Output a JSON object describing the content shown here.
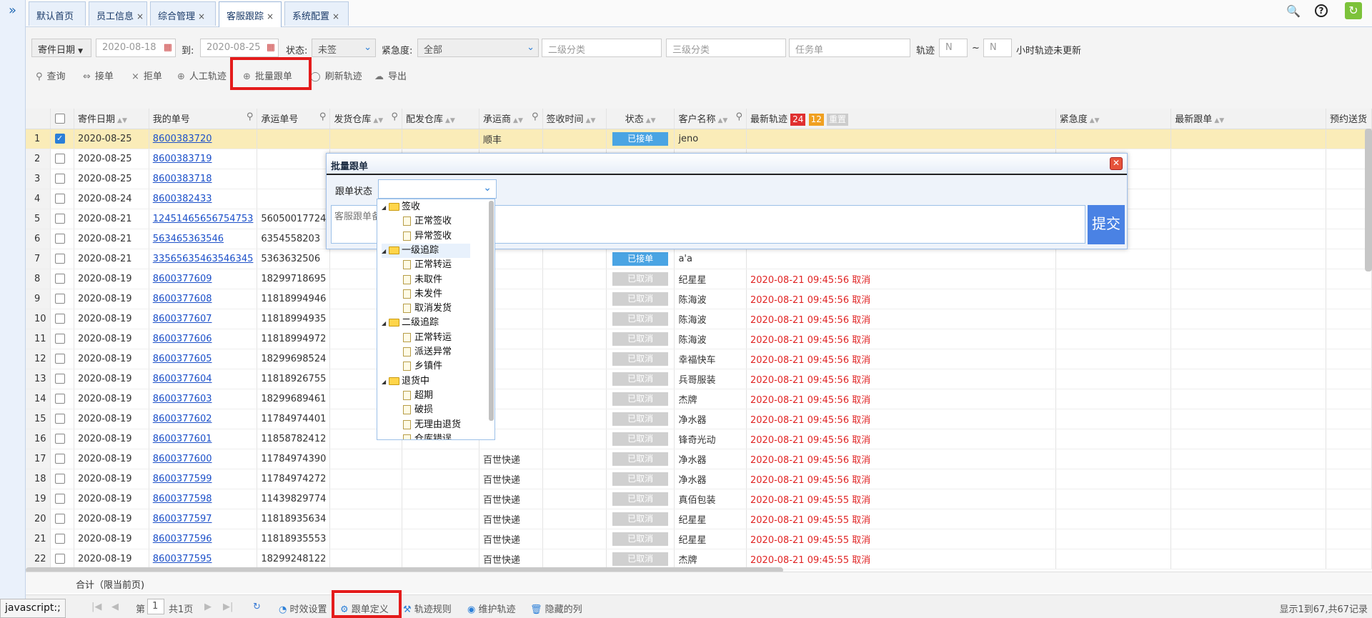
{
  "tabs": [
    "默认首页",
    "员工信息",
    "综合管理",
    "客服跟踪",
    "系统配置"
  ],
  "filter": {
    "date_type": "寄件日期",
    "date_from": "2020-08-18",
    "to_label": "到:",
    "date_to": "2020-08-25",
    "status_label": "状态:",
    "status_value": "未签",
    "urgency_label": "紧急度:",
    "urgency_value": "全部",
    "level2_placeholder": "二级分类",
    "level3_placeholder": "三级分类",
    "task_placeholder": "任务单",
    "track_label": "轨迹",
    "n1_placeholder": "N",
    "tilde": "~",
    "n2_placeholder": "N",
    "not_updated": "小时轨迹未更新"
  },
  "toolbar": {
    "query": "查询",
    "accept": "接单",
    "reject": "拒单",
    "manual_track": "人工轨迹",
    "batch_follow": "批量跟单",
    "refresh_track": "刷新轨迹",
    "export": "导出"
  },
  "columns": {
    "date": "寄件日期",
    "my_no": "我的单号",
    "carrier_no": "承运单号",
    "ship_wh": "发货仓库",
    "dist_wh": "配发仓库",
    "carrier": "承运商",
    "sign_time": "签收时间",
    "status": "状态",
    "customer": "客户名称",
    "latest_track": "最新轨迹",
    "cnt_red": "24",
    "cnt_orange": "12",
    "cnt_gray": "重置",
    "urgency": "紧急度",
    "latest_follow": "最新跟单",
    "eta": "预约送货"
  },
  "rows": [
    {
      "n": "1",
      "date": "2020-08-25",
      "my": "8600383720",
      "cn": "",
      "car": "顺丰",
      "st": "已接单",
      "cust": "jeno",
      "trk": ""
    },
    {
      "n": "2",
      "date": "2020-08-25",
      "my": "8600383719",
      "cn": "",
      "car": "",
      "st": "",
      "cust": "",
      "trk": ""
    },
    {
      "n": "3",
      "date": "2020-08-25",
      "my": "8600383718",
      "cn": "",
      "car": "",
      "st": "",
      "cust": "",
      "trk": ""
    },
    {
      "n": "4",
      "date": "2020-08-24",
      "my": "8600382433",
      "cn": "",
      "car": "",
      "st": "",
      "cust": "",
      "trk": ""
    },
    {
      "n": "5",
      "date": "2020-08-21",
      "my": "12451465656754753",
      "cn": "56050017724",
      "car": "",
      "st": "",
      "cust": "",
      "trk": ""
    },
    {
      "n": "6",
      "date": "2020-08-21",
      "my": "563465363546",
      "cn": "6354558203",
      "car": "",
      "st": "",
      "cust": "",
      "trk": ""
    },
    {
      "n": "7",
      "date": "2020-08-21",
      "my": "33565635463546345",
      "cn": "5363632506",
      "car": "",
      "st": "已接单",
      "cust": "a'a",
      "trk": ""
    },
    {
      "n": "8",
      "date": "2020-08-19",
      "my": "8600377609",
      "cn": "18299718695",
      "car": "",
      "st": "已取消",
      "cust": "纪星星",
      "trk": "2020-08-21 09:45:56 取消"
    },
    {
      "n": "9",
      "date": "2020-08-19",
      "my": "8600377608",
      "cn": "11818994946",
      "car": "",
      "st": "已取消",
      "cust": "陈海波",
      "trk": "2020-08-21 09:45:56 取消"
    },
    {
      "n": "10",
      "date": "2020-08-19",
      "my": "8600377607",
      "cn": "11818994935",
      "car": "",
      "st": "已取消",
      "cust": "陈海波",
      "trk": "2020-08-21 09:45:56 取消"
    },
    {
      "n": "11",
      "date": "2020-08-19",
      "my": "8600377606",
      "cn": "11818994972",
      "car": "",
      "st": "已取消",
      "cust": "陈海波",
      "trk": "2020-08-21 09:45:56 取消"
    },
    {
      "n": "12",
      "date": "2020-08-19",
      "my": "8600377605",
      "cn": "18299698524",
      "car": "",
      "st": "已取消",
      "cust": "幸福快车",
      "trk": "2020-08-21 09:45:56 取消"
    },
    {
      "n": "13",
      "date": "2020-08-19",
      "my": "8600377604",
      "cn": "11818926755",
      "car": "",
      "st": "已取消",
      "cust": "兵哥服装",
      "trk": "2020-08-21 09:45:56 取消"
    },
    {
      "n": "14",
      "date": "2020-08-19",
      "my": "8600377603",
      "cn": "18299689461",
      "car": "",
      "st": "已取消",
      "cust": "杰牌",
      "trk": "2020-08-21 09:45:56 取消"
    },
    {
      "n": "15",
      "date": "2020-08-19",
      "my": "8600377602",
      "cn": "11784974401",
      "car": "",
      "st": "已取消",
      "cust": "净水器",
      "trk": "2020-08-21 09:45:56 取消"
    },
    {
      "n": "16",
      "date": "2020-08-19",
      "my": "8600377601",
      "cn": "11858782412",
      "car": "",
      "st": "已取消",
      "cust": "锋奇光动",
      "trk": "2020-08-21 09:45:56 取消"
    },
    {
      "n": "17",
      "date": "2020-08-19",
      "my": "8600377600",
      "cn": "11784974390",
      "car": "百世快递",
      "st": "已取消",
      "cust": "净水器",
      "trk": "2020-08-21 09:45:56 取消"
    },
    {
      "n": "18",
      "date": "2020-08-19",
      "my": "8600377599",
      "cn": "11784974272",
      "car": "百世快递",
      "st": "已取消",
      "cust": "净水器",
      "trk": "2020-08-21 09:45:56 取消"
    },
    {
      "n": "19",
      "date": "2020-08-19",
      "my": "8600377598",
      "cn": "11439829774",
      "car": "百世快递",
      "st": "已取消",
      "cust": "真佰包装",
      "trk": "2020-08-21 09:45:55 取消"
    },
    {
      "n": "20",
      "date": "2020-08-19",
      "my": "8600377597",
      "cn": "11818935634",
      "car": "百世快递",
      "st": "已取消",
      "cust": "纪星星",
      "trk": "2020-08-21 09:45:55 取消"
    },
    {
      "n": "21",
      "date": "2020-08-19",
      "my": "8600377596",
      "cn": "11818935553",
      "car": "百世快递",
      "st": "已取消",
      "cust": "纪星星",
      "trk": "2020-08-21 09:45:55 取消"
    },
    {
      "n": "22",
      "date": "2020-08-19",
      "my": "8600377595",
      "cn": "18299248122",
      "car": "百世快递",
      "st": "已取消",
      "cust": "杰牌",
      "trk": "2020-08-21 09:45:55 取消"
    }
  ],
  "summary": "合计（限当前页)",
  "pager": {
    "page_label": "第",
    "page": "1",
    "total_pages": "共1页",
    "timing": "时效设置",
    "follow_def": "跟单定义",
    "track_rules": "轨迹规则",
    "maintain_track": "维护轨迹",
    "hidden_cols": "隐藏的列",
    "range": "显示1到67,共67记录"
  },
  "status_url": "javascript:;",
  "dialog": {
    "title": "批量跟单",
    "status_label": "跟单状态",
    "note_placeholder": "客服跟单备注",
    "submit": "提交",
    "tree": [
      {
        "label": "签收",
        "type": "folder",
        "level": 0
      },
      {
        "label": "正常签收",
        "type": "doc",
        "level": 1
      },
      {
        "label": "异常签收",
        "type": "doc",
        "level": 1
      },
      {
        "label": "一级追踪",
        "type": "folder",
        "level": 0
      },
      {
        "label": "正常转运",
        "type": "doc",
        "level": 1
      },
      {
        "label": "未取件",
        "type": "doc",
        "level": 1
      },
      {
        "label": "未发件",
        "type": "doc",
        "level": 1
      },
      {
        "label": "取消发货",
        "type": "doc",
        "level": 1
      },
      {
        "label": "二级追踪",
        "type": "folder",
        "level": 0
      },
      {
        "label": "正常转运",
        "type": "doc",
        "level": 1
      },
      {
        "label": "派送异常",
        "type": "doc",
        "level": 1
      },
      {
        "label": "乡镇件",
        "type": "doc",
        "level": 1
      },
      {
        "label": "退货中",
        "type": "folder",
        "level": 0
      },
      {
        "label": "超期",
        "type": "doc",
        "level": 1
      },
      {
        "label": "破损",
        "type": "doc",
        "level": 1
      },
      {
        "label": "无理由退货",
        "type": "doc",
        "level": 1
      },
      {
        "label": "仓库错误",
        "type": "doc",
        "level": 1
      }
    ]
  },
  "colors": {
    "accent": "#1c50c9",
    "red_box": "#e41b1b",
    "badge_ok": "#4aa4e3",
    "badge_cancel": "#d0d0d0",
    "highlight": "#faecb8",
    "cancel_text": "#e02424"
  }
}
